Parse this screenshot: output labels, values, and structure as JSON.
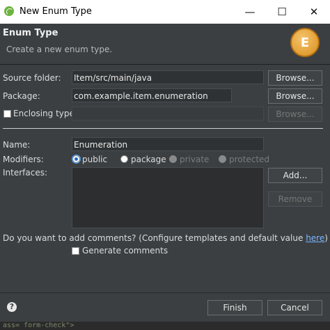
{
  "window": {
    "title": "New Enum Type",
    "minimize": "—",
    "maximize": "☐",
    "close": "✕"
  },
  "header": {
    "title": "Enum Type",
    "subtitle": "Create a new enum type.",
    "badge_letter": "E"
  },
  "form": {
    "source_folder": {
      "label": "Source folder:",
      "value": "Item/src/main/java",
      "browse": "Browse..."
    },
    "package": {
      "label": "Package:",
      "value": "com.example.item.enumeration",
      "browse": "Browse..."
    },
    "enclosing_type": {
      "label": "Enclosing type:",
      "value": "",
      "browse": "Browse...",
      "checked": false
    },
    "name": {
      "label": "Name:",
      "value": "Enumeration"
    },
    "modifiers": {
      "label": "Modifiers:",
      "options": [
        "public",
        "package",
        "private",
        "protected"
      ],
      "selected": "public"
    },
    "interfaces": {
      "label": "Interfaces:",
      "add": "Add...",
      "remove": "Remove"
    },
    "comments": {
      "question": "Do you want to add comments? (Configure templates and default value ",
      "link": "here",
      "close_paren": ")",
      "generate_label": "Generate comments"
    }
  },
  "footer": {
    "help": "?",
    "finish": "Finish",
    "cancel": "Cancel"
  },
  "background_text": "ass= form-check\">"
}
